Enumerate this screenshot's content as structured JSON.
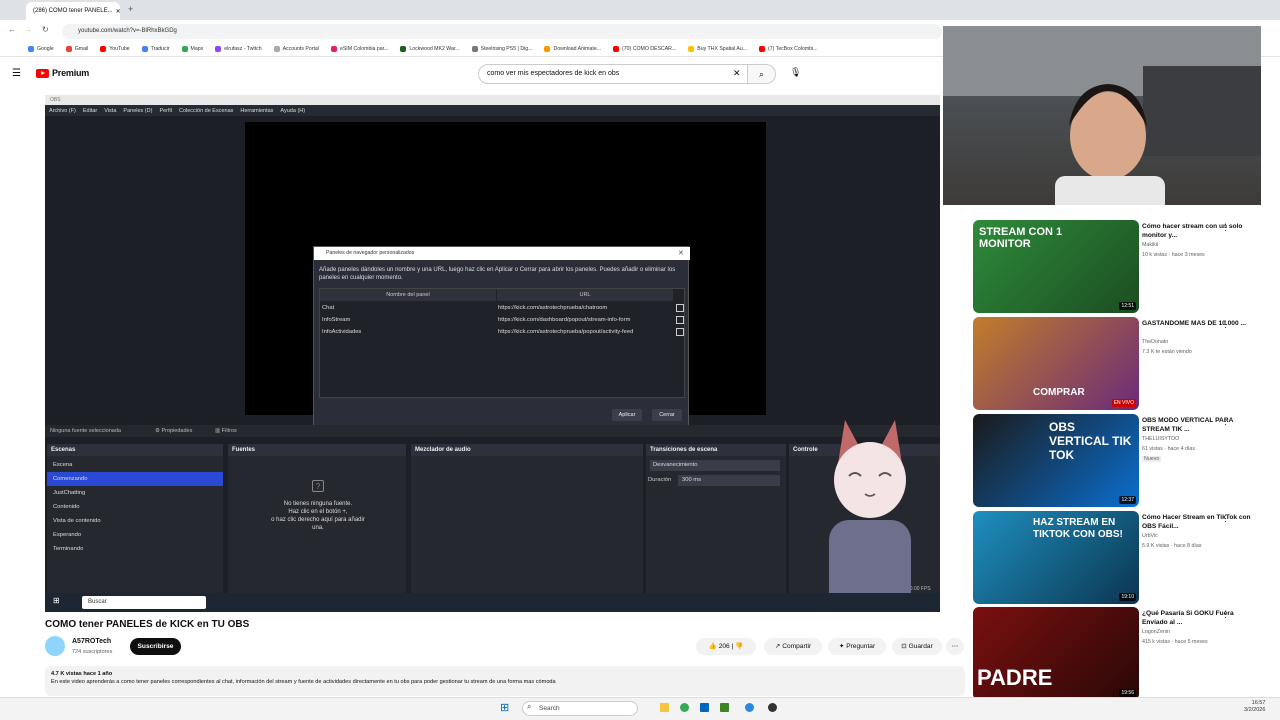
{
  "browser": {
    "tab_title": "(286) COMO tener PANELE...",
    "url": "youtube.com/watch?v=-BlRhxBkGDg",
    "bookmarks": [
      "Google",
      "Gmail",
      "YouTube",
      "Traducir",
      "Maps",
      "elrufasz - Twitch",
      "Accounts Portal",
      "eSIM Colombia par...",
      "Lockwood MK2 War...",
      "Steelrising PS5 | Dig...",
      "Download Animate...",
      "(70) COMO DESCAR...",
      "Buy THX Spatial Au...",
      "(7) TecBox Colombi..."
    ]
  },
  "youtube": {
    "logo": "Premium",
    "search_value": "como ver mis espectadores de kick en obs"
  },
  "obs": {
    "menu": [
      "Archivo (F)",
      "Editar",
      "Vista",
      "Paneles (D)",
      "Perfil",
      "Colección de Escenas",
      "Herramientas",
      "Ayuda (H)"
    ],
    "dialog": {
      "title": "Paneles de navegador personalizados",
      "text": "Añade paneles dándoles un nombre y una URL, luego haz clic en Aplicar o Cerrar para abrir los paneles. Puedes añadir o eliminar los paneles en cualquier momento.",
      "col_name": "Nombre del panel",
      "col_url": "URL",
      "rows": [
        {
          "name": "Chat",
          "url": "https://kick.com/astrotechprueba/chatroom"
        },
        {
          "name": "InfoStream",
          "url": "https://kick.com/dashboard/popout/stream-info-form"
        },
        {
          "name": "InfoActividades",
          "url": "https://kick.com/astrotechprueba/popout/activity-feed"
        }
      ],
      "apply": "Aplicar",
      "close": "Cerrar"
    },
    "source_bar": {
      "no_source": "Ninguna fuente seleccionada",
      "properties": "Propiedades",
      "filters": "Filtros"
    },
    "panels": {
      "scenes_title": "Escenas",
      "scenes": [
        "Escena",
        "Comenzando",
        "JustChatting",
        "Contenido",
        "Vista de contenido",
        "Esperando",
        "Terminando"
      ],
      "selected_scene": "Comenzando",
      "sources_title": "Fuentes",
      "sources_empty": "No tienes ninguna fuente.\nHaz clic en el botón +,\no haz clic derecho aquí para añadir\nuna.",
      "mixer_title": "Mezclador de audio",
      "transitions_title": "Transiciones de escena",
      "transition": "Desvanecimiento",
      "duration_label": "Duración",
      "duration_value": "300 ms",
      "controls_title": "Controle",
      "fps": "30.00 FPS"
    },
    "taskbar_search": "Buscar"
  },
  "sidebar": [
    {
      "title": "Cómo hacer stream con un solo monitor y...",
      "channel": "Makikii",
      "meta": "10 k vistas · hace 3 meses",
      "duration": "12:51",
      "thumb_text": "STREAM CON 1 MONITOR",
      "colors": [
        "#2e8b3a",
        "#1c4d22"
      ]
    },
    {
      "title": "GASTANDOME MAS DE 10.000 ...",
      "channel": "TheDonato",
      "meta": "7.3 K te están viendo",
      "duration": "EN VIVO",
      "thumb_text": "COMPRAR",
      "colors": [
        "#c27d2a",
        "#6b2a7a"
      ]
    },
    {
      "title": "OBS MODO VERTICAL PARA STREAM TIK ...",
      "channel": "THELUISYTOO",
      "meta": "61 vistas · hace 4 días",
      "badge": "Nuevo",
      "duration": "12:37",
      "thumb_text": "OBS VERTICAL TIK TOK",
      "colors": [
        "#1a1a1a",
        "#0b6fd0"
      ]
    },
    {
      "title": "Cómo Hacer Stream en TikTok con OBS Fácil...",
      "channel": "UrbVic",
      "meta": "5.9 K vistas · hace 8 días",
      "duration": "19:10",
      "thumb_text": "HAZ STREAM EN TIKTOK CON OBS!",
      "colors": [
        "#1f8fbf",
        "#0b3550"
      ]
    },
    {
      "title": "¿Qué Pasaría Si GOKU Fuera Enviado al ...",
      "channel": "LogonZenin",
      "meta": "415 k vistas · hace 5 meses",
      "duration": "19:56",
      "thumb_text": "PADRE",
      "colors": [
        "#7a1010",
        "#2a0707"
      ]
    }
  ],
  "video": {
    "title": "COMO tener PANELES de KICK en TU OBS",
    "channel": "A57ROTech",
    "subscribers": "724 suscriptores",
    "subscribe": "Suscribirse",
    "likes": "206",
    "share": "Compartir",
    "ask": "Preguntar",
    "save": "Guardar",
    "views": "4.7 K vistas  hace 1 año",
    "description": "En este video aprenderás a como tener paneles correspondientes al chat, información del stream y fuente de actividades directamente en tu obs para poder gestionar tu stream de una forma mas cómoda"
  },
  "windows": {
    "search": "Search",
    "time": "16:57",
    "date": "3/2/2026"
  },
  "colors": {
    "accent": "#ff0000",
    "obs_select": "#2a4ad6"
  }
}
